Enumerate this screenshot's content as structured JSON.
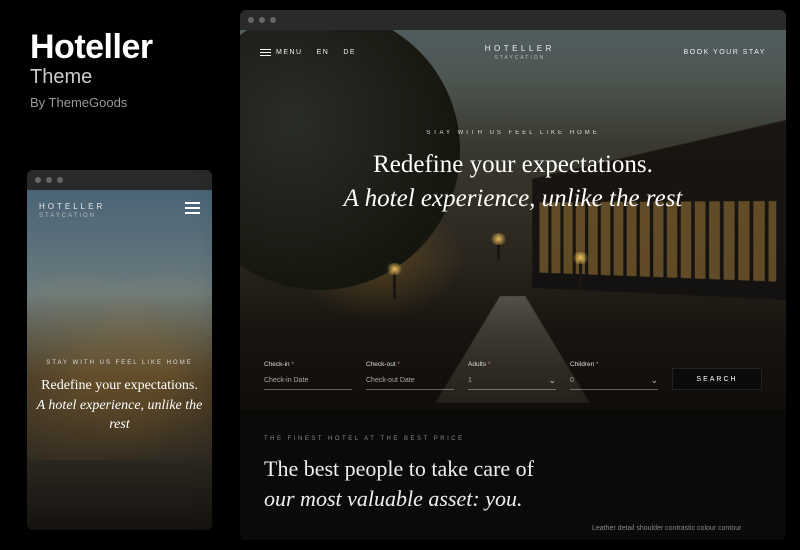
{
  "promo": {
    "title": "Hoteller",
    "subtitle": "Theme",
    "credit": "By ThemeGoods"
  },
  "brand": {
    "name": "HOTELLER",
    "tagline": "STAYCATION"
  },
  "hero": {
    "eyebrow": "STAY WITH US FEEL LIKE HOME",
    "line1": "Redefine your expectations.",
    "line2": "A hotel experience, unlike the rest"
  },
  "nav": {
    "menu": "MENU",
    "lang1": "EN",
    "lang2": "DE",
    "cta": "BOOK YOUR STAY"
  },
  "booking": {
    "checkin_label": "Check-in",
    "checkin_ph": "Check-in Date",
    "checkout_label": "Check-out",
    "checkout_ph": "Check-out Date",
    "adults_label": "Adults",
    "adults_val": "1",
    "children_label": "Children",
    "children_val": "0",
    "search": "SEARCH"
  },
  "lower": {
    "eyebrow": "THE FINEST HOTEL AT THE BEST PRICE",
    "line1": "The best people to take care of",
    "line2": "our most valuable asset: you.",
    "para": "Leather detail shoulder contrastic colour contour"
  }
}
